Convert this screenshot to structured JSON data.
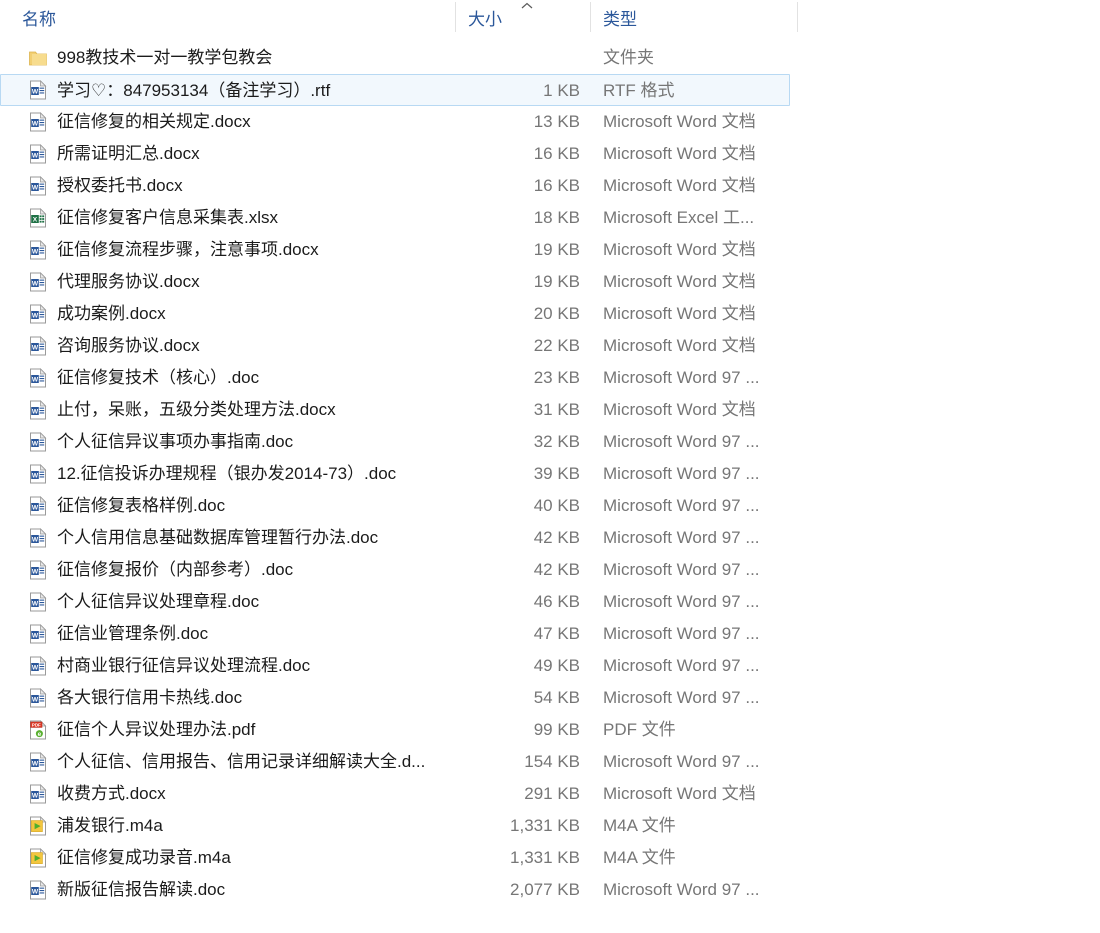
{
  "window": {
    "view": "details",
    "accent_color": "#2b579a",
    "selection_fill": "#f2f8fd",
    "selection_border": "#b8d9f3"
  },
  "columns": {
    "name": {
      "label": "名称",
      "sorted": false
    },
    "size": {
      "label": "大小",
      "sorted": true,
      "sort_direction": "ascending",
      "sort_glyph": "^"
    },
    "type": {
      "label": "类型",
      "sorted": false
    }
  },
  "files": [
    {
      "name": "998教技术一对一教学包教会",
      "size": "",
      "type": "文件夹",
      "icon": "folder-icon",
      "selected": false
    },
    {
      "name": "学习♡：847953134（备注学习）.rtf",
      "size": "1 KB",
      "type": "RTF 格式",
      "icon": "word-doc-icon",
      "selected": true
    },
    {
      "name": "征信修复的相关规定.docx",
      "size": "13 KB",
      "type": "Microsoft Word 文档",
      "icon": "word-docx-icon",
      "selected": false
    },
    {
      "name": "所需证明汇总.docx",
      "size": "16 KB",
      "type": "Microsoft Word 文档",
      "icon": "word-docx-icon",
      "selected": false
    },
    {
      "name": "授权委托书.docx",
      "size": "16 KB",
      "type": "Microsoft Word 文档",
      "icon": "word-docx-icon",
      "selected": false
    },
    {
      "name": "征信修复客户信息采集表.xlsx",
      "size": "18 KB",
      "type": "Microsoft Excel 工...",
      "icon": "excel-icon",
      "selected": false
    },
    {
      "name": "征信修复流程步骤，注意事项.docx",
      "size": "19 KB",
      "type": "Microsoft Word 文档",
      "icon": "word-docx-icon",
      "selected": false
    },
    {
      "name": "代理服务协议.docx",
      "size": "19 KB",
      "type": "Microsoft Word 文档",
      "icon": "word-docx-icon",
      "selected": false
    },
    {
      "name": "成功案例.docx",
      "size": "20 KB",
      "type": "Microsoft Word 文档",
      "icon": "word-docx-icon",
      "selected": false
    },
    {
      "name": "咨询服务协议.docx",
      "size": "22 KB",
      "type": "Microsoft Word 文档",
      "icon": "word-docx-icon",
      "selected": false
    },
    {
      "name": "征信修复技术（核心）.doc",
      "size": "23 KB",
      "type": "Microsoft Word 97 ...",
      "icon": "word-doc-icon",
      "selected": false
    },
    {
      "name": "止付，呆账，五级分类处理方法.docx",
      "size": "31 KB",
      "type": "Microsoft Word 文档",
      "icon": "word-docx-icon",
      "selected": false
    },
    {
      "name": "个人征信异议事项办事指南.doc",
      "size": "32 KB",
      "type": "Microsoft Word 97 ...",
      "icon": "word-doc-icon",
      "selected": false
    },
    {
      "name": "12.征信投诉办理规程（银办发2014-73）.doc",
      "size": "39 KB",
      "type": "Microsoft Word 97 ...",
      "icon": "word-doc-icon",
      "selected": false
    },
    {
      "name": "征信修复表格样例.doc",
      "size": "40 KB",
      "type": "Microsoft Word 97 ...",
      "icon": "word-doc-icon",
      "selected": false
    },
    {
      "name": "个人信用信息基础数据库管理暂行办法.doc",
      "size": "42 KB",
      "type": "Microsoft Word 97 ...",
      "icon": "word-doc-icon",
      "selected": false
    },
    {
      "name": "征信修复报价（内部参考）.doc",
      "size": "42 KB",
      "type": "Microsoft Word 97 ...",
      "icon": "word-doc-icon",
      "selected": false
    },
    {
      "name": "个人征信异议处理章程.doc",
      "size": "46 KB",
      "type": "Microsoft Word 97 ...",
      "icon": "word-doc-icon",
      "selected": false
    },
    {
      "name": "征信业管理条例.doc",
      "size": "47 KB",
      "type": "Microsoft Word 97 ...",
      "icon": "word-doc-icon",
      "selected": false
    },
    {
      "name": "村商业银行征信异议处理流程.doc",
      "size": "49 KB",
      "type": "Microsoft Word 97 ...",
      "icon": "word-doc-icon",
      "selected": false
    },
    {
      "name": "各大银行信用卡热线.doc",
      "size": "54 KB",
      "type": "Microsoft Word 97 ...",
      "icon": "word-doc-icon",
      "selected": false
    },
    {
      "name": "征信个人异议处理办法.pdf",
      "size": "99 KB",
      "type": "PDF 文件",
      "icon": "pdf-icon",
      "selected": false
    },
    {
      "name": "个人征信、信用报告、信用记录详细解读大全.d...",
      "size": "154 KB",
      "type": "Microsoft Word 97 ...",
      "icon": "word-doc-icon",
      "selected": false
    },
    {
      "name": "收费方式.docx",
      "size": "291 KB",
      "type": "Microsoft Word 文档",
      "icon": "word-docx-icon",
      "selected": false
    },
    {
      "name": "浦发银行.m4a",
      "size": "1,331 KB",
      "type": "M4A 文件",
      "icon": "media-audio-icon",
      "selected": false
    },
    {
      "name": "征信修复成功录音.m4a",
      "size": "1,331 KB",
      "type": "M4A 文件",
      "icon": "media-audio-icon",
      "selected": false
    },
    {
      "name": "新版征信报告解读.doc",
      "size": "2,077 KB",
      "type": "Microsoft Word 97 ...",
      "icon": "word-doc-icon",
      "selected": false
    }
  ]
}
